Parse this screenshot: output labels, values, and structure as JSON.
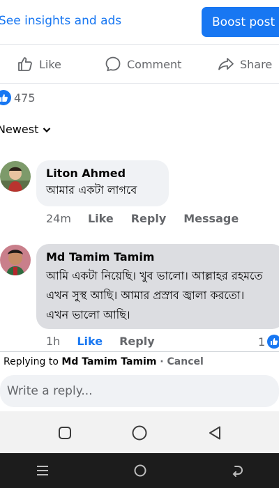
{
  "header": {
    "insights_label": "See insights and ads",
    "boost_label": "Boost post"
  },
  "actions": {
    "like": "Like",
    "comment": "Comment",
    "share": "Share"
  },
  "reactions": {
    "count": "475"
  },
  "sort": {
    "label": "Newest"
  },
  "comments": [
    {
      "author": "Liton Ahmed",
      "text": "আমার একটা লাগবে",
      "time": "24m",
      "like": "Like",
      "reply": "Reply",
      "message": "Message"
    },
    {
      "author": "Md Tamim Tamim",
      "text": "আমি একটা নিয়েছি। খুব ভালো। আল্লাহর রহমতে এখন সুস্থ আছি।  আমার প্রস্রাব জ্বালা করতো। এখন ভালো আছি।",
      "time": "1h",
      "like": "Like",
      "reply": "Reply",
      "reaction_count": "1"
    }
  ],
  "reply_bar": {
    "prefix": "Replying to",
    "name": "Md Tamim Tamim",
    "separator": " · ",
    "cancel": "Cancel",
    "placeholder": "Write a reply..."
  },
  "colors": {
    "accent": "#1877f2",
    "bubble": "#f0f2f5",
    "bubble_selected": "#dcdde1",
    "muted": "#65676b"
  },
  "icons": {
    "like": "thumbs-up-icon",
    "comment": "comment-bubble-icon",
    "share": "share-arrow-icon",
    "reaction": "like-reaction-icon",
    "sort": "chevron-down-icon",
    "nav_recent": "recents-square-icon",
    "nav_home": "home-circle-icon",
    "nav_back": "back-triangle-icon",
    "sys_menu": "menu-lines-icon",
    "sys_home": "home-circle-icon",
    "sys_back": "back-arrow-icon"
  }
}
